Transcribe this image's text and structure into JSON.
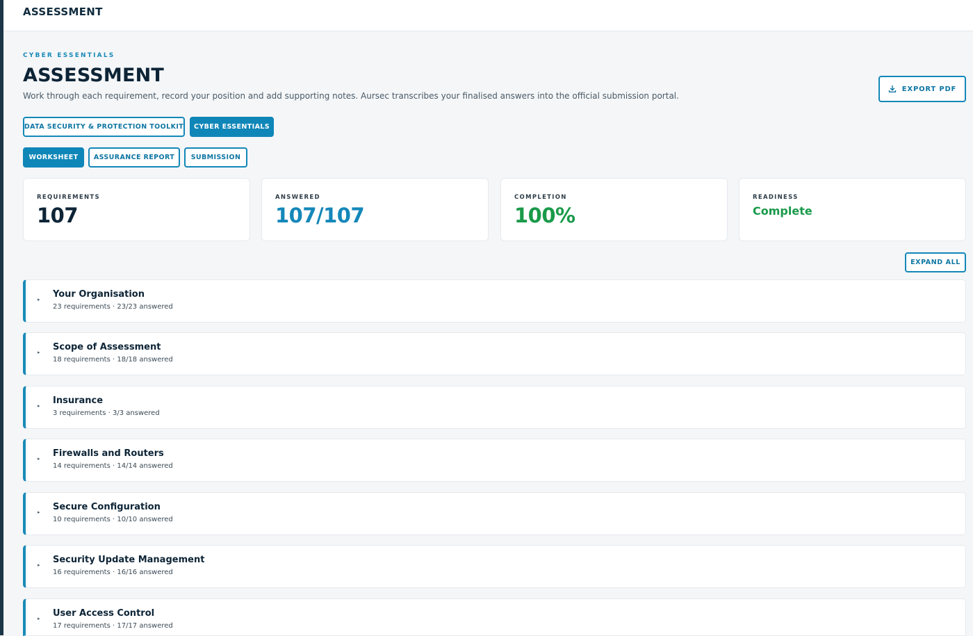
{
  "topbar": {
    "title": "ASSESSMENT"
  },
  "header": {
    "eyebrow": "CYBER ESSENTIALS",
    "title": "ASSESSMENT",
    "subtitle": "Work through each requirement, record your position and add supporting notes. Aursec transcribes your finalised answers into the official submission portal.",
    "export_label": "EXPORT PDF"
  },
  "frameworks": [
    {
      "label": "DATA SECURITY & PROTECTION TOOLKIT",
      "active": false
    },
    {
      "label": "CYBER ESSENTIALS",
      "active": true
    }
  ],
  "views": [
    {
      "label": "WORKSHEET",
      "active": true
    },
    {
      "label": "ASSURANCE REPORT",
      "active": false
    },
    {
      "label": "SUBMISSION",
      "active": false
    }
  ],
  "stats": [
    {
      "label": "REQUIREMENTS",
      "value": "107",
      "color": "#0d2436"
    },
    {
      "label": "ANSWERED",
      "value": "107/107",
      "color": "#1487b9"
    },
    {
      "label": "COMPLETION",
      "value": "100%",
      "color": "#1a9a4a"
    },
    {
      "label": "READINESS",
      "value": "Complete",
      "color": "#1a9a4a"
    }
  ],
  "expand_label": "EXPAND ALL",
  "sections": [
    {
      "title": "Your Organisation",
      "meta": "23 requirements · 23/23 answered"
    },
    {
      "title": "Scope of Assessment",
      "meta": "18 requirements · 18/18 answered"
    },
    {
      "title": "Insurance",
      "meta": "3 requirements · 3/3 answered"
    },
    {
      "title": "Firewalls and Routers",
      "meta": "14 requirements · 14/14 answered"
    },
    {
      "title": "Secure Configuration",
      "meta": "10 requirements · 10/10 answered"
    },
    {
      "title": "Security Update Management",
      "meta": "16 requirements · 16/16 answered"
    },
    {
      "title": "User Access Control",
      "meta": "17 requirements · 17/17 answered"
    }
  ],
  "colors": {
    "accent": "#0f86b8",
    "success": "#1a9a4a",
    "navy": "#0d2436"
  }
}
